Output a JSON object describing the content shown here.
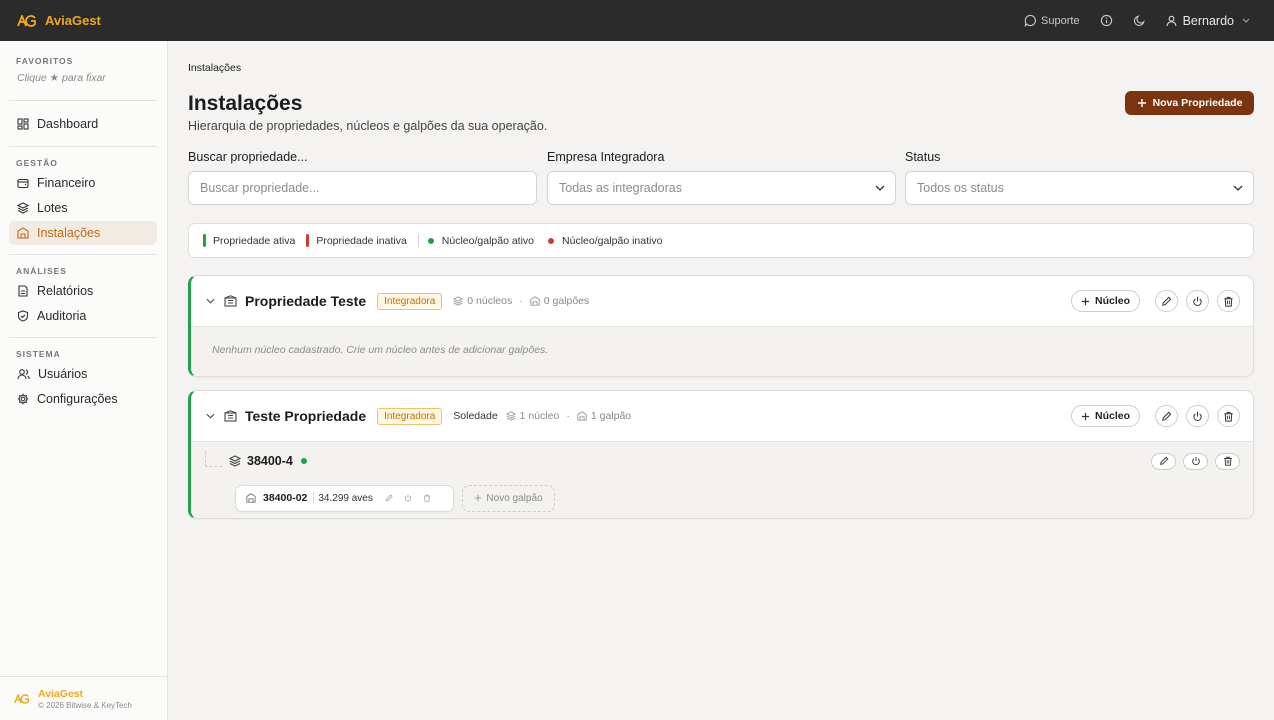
{
  "app": {
    "name": "AviaGest"
  },
  "topbar": {
    "support_label": "Suporte",
    "user_name": "Bernardo"
  },
  "sidebar": {
    "favorites_title": "FAVORITOS",
    "favorites_hint": "Clique ★ para fixar",
    "dashboard_label": "Dashboard",
    "gestao_title": "GESTÃO",
    "gestao_items": [
      {
        "label": "Financeiro",
        "icon": "wallet-icon"
      },
      {
        "label": "Lotes",
        "icon": "layers-icon"
      },
      {
        "label": "Instalações",
        "icon": "building-icon",
        "active": true
      }
    ],
    "analises_title": "ANÁLISES",
    "analises_items": [
      {
        "label": "Relatórios",
        "icon": "report-icon"
      },
      {
        "label": "Auditoria",
        "icon": "shield-icon"
      }
    ],
    "sistema_title": "SISTEMA",
    "sistema_items": [
      {
        "label": "Usuários",
        "icon": "users-icon"
      },
      {
        "label": "Configurações",
        "icon": "gear-icon"
      }
    ],
    "footer_name": "AviaGest",
    "footer_copy": "© 2026 Bitwise & KeyTech"
  },
  "page": {
    "breadcrumb": "Instalações",
    "title": "Instalações",
    "subtitle": "Hierarquia de propriedades, núcleos e galpões da sua operação.",
    "new_button": "Nova Propriedade"
  },
  "filters": {
    "search_label": "Buscar propriedade...",
    "search_placeholder": "Buscar propriedade...",
    "integrator_label": "Empresa Integradora",
    "integrator_value": "Todas as integradoras",
    "status_label": "Status",
    "status_value": "Todos os status"
  },
  "legend": {
    "active_property": "Propriedade ativa",
    "inactive_property": "Propriedade inativa",
    "active_nucleo": "Núcleo/galpão ativo",
    "inactive_nucleo": "Núcleo/galpão inativo",
    "colors": {
      "active": "#22a04a",
      "inactive": "#d63a2f"
    }
  },
  "properties": [
    {
      "name": "Propriedade Teste",
      "badge": "Integradora",
      "nucleos": "0 núcleos",
      "galpoes": "0 galpões",
      "empty_message": "Nenhum núcleo cadastrado. Crie um núcleo antes de adicionar galpões.",
      "add_nucleo": "Núcleo"
    },
    {
      "name": "Teste Propriedade",
      "badge": "Integradora",
      "city": "Soledade",
      "nucleos": "1 núcleo",
      "galpoes": "1 galpão",
      "add_nucleo": "Núcleo",
      "nucleo": {
        "name": "38400-4",
        "galpao_name": "38400-02",
        "galpao_count": "34.299 aves",
        "new_galpao": "Novo galpão"
      }
    }
  ]
}
